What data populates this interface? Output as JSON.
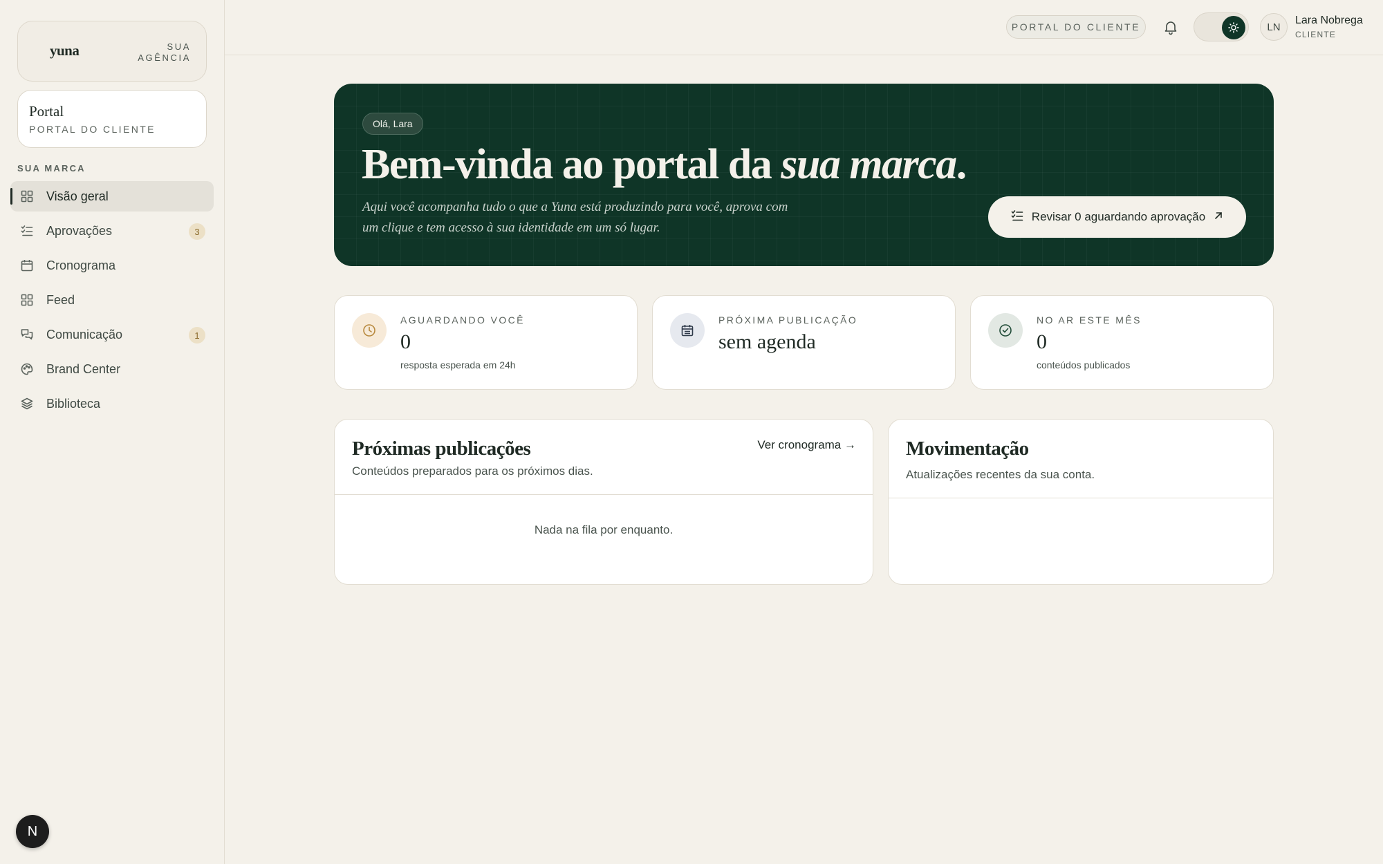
{
  "sidebar": {
    "brand_logo": "yuna",
    "brand_agency_line1": "SUA",
    "brand_agency_line2": "AGÊNCIA",
    "portal_title": "Portal",
    "portal_subtitle": "PORTAL DO CLIENTE",
    "section_label": "SUA MARCA",
    "items": [
      {
        "label": "Visão geral",
        "icon": "grid-icon",
        "active": true
      },
      {
        "label": "Aprovações",
        "icon": "checklist-icon",
        "badge": "3"
      },
      {
        "label": "Cronograma",
        "icon": "calendar-icon"
      },
      {
        "label": "Feed",
        "icon": "grid-icon"
      },
      {
        "label": "Comunicação",
        "icon": "chat-icon",
        "badge": "1"
      },
      {
        "label": "Brand Center",
        "icon": "palette-icon"
      },
      {
        "label": "Biblioteca",
        "icon": "layers-icon"
      }
    ],
    "bottom_button": "N"
  },
  "topbar": {
    "portal_pill": "PORTAL DO CLIENTE",
    "avatar_initials": "LN",
    "user_name": "Lara Nobrega",
    "user_role": "CLIENTE"
  },
  "hero": {
    "greeting": "Olá, Lara",
    "title_start": "Bem-vinda ao portal da ",
    "title_emphasis": "sua marca",
    "title_end": ".",
    "description": "Aqui você acompanha tudo o que a Yuna está produzindo para você, aprova com um clique e tem acesso à sua identidade em um só lugar.",
    "cta_label": "Revisar 0 aguardando aprovação"
  },
  "stats": [
    {
      "label": "AGUARDANDO VOCÊ",
      "value": "0",
      "sub": "resposta esperada em 24h",
      "icon": "clock-icon"
    },
    {
      "label": "PRÓXIMA PUBLICAÇÃO",
      "value": "sem agenda",
      "sub": "",
      "icon": "calendar-icon"
    },
    {
      "label": "NO AR ESTE MÊS",
      "value": "0",
      "sub": "conteúdos publicados",
      "icon": "check-circle-icon"
    }
  ],
  "upcoming": {
    "title": "Próximas publicações",
    "subtitle": "Conteúdos preparados para os próximos dias.",
    "link": "Ver cronograma →",
    "empty": "Nada na fila por enquanto."
  },
  "activity": {
    "title": "Movimentação",
    "subtitle": "Atualizações recentes da sua conta."
  },
  "colors": {
    "background": "#f4f1ea",
    "hero": "#0f3527",
    "badge": "#ece0c6",
    "clock_bg": "#f7ead8",
    "calendar_bg": "#e6e9ef",
    "check_bg": "#e2e8e3"
  }
}
